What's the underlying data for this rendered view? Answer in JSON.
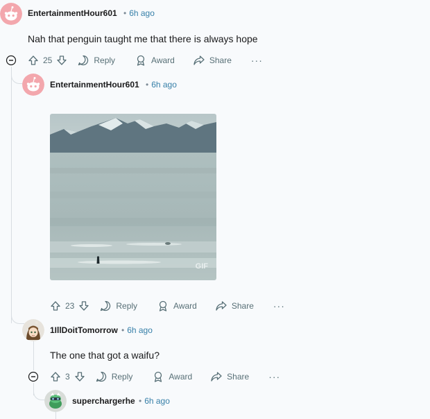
{
  "comments": [
    {
      "author": "EntertainmentHour601",
      "time": "6h ago",
      "body": "Nah that penguin taught me that there is always hope",
      "score": "25",
      "actions": {
        "reply": "Reply",
        "award": "Award",
        "share": "Share",
        "more": "···"
      }
    },
    {
      "author": "EntertainmentHour601",
      "time": "6h ago",
      "media_badge": "GIF",
      "score": "23",
      "actions": {
        "reply": "Reply",
        "award": "Award",
        "share": "Share",
        "more": "···"
      }
    },
    {
      "author": "1IllDoitTomorrow",
      "time": "6h ago",
      "body": "The one that got a waifu?",
      "score": "3",
      "actions": {
        "reply": "Reply",
        "award": "Award",
        "share": "Share",
        "more": "···"
      }
    },
    {
      "author": "superchargerhe",
      "time": "6h ago"
    }
  ],
  "colors": {
    "background": "#f8fafc",
    "username": "#1a1a1b",
    "timestamp": "#367fa8",
    "meta": "#576f76",
    "thread_line": "#d8dde2"
  }
}
